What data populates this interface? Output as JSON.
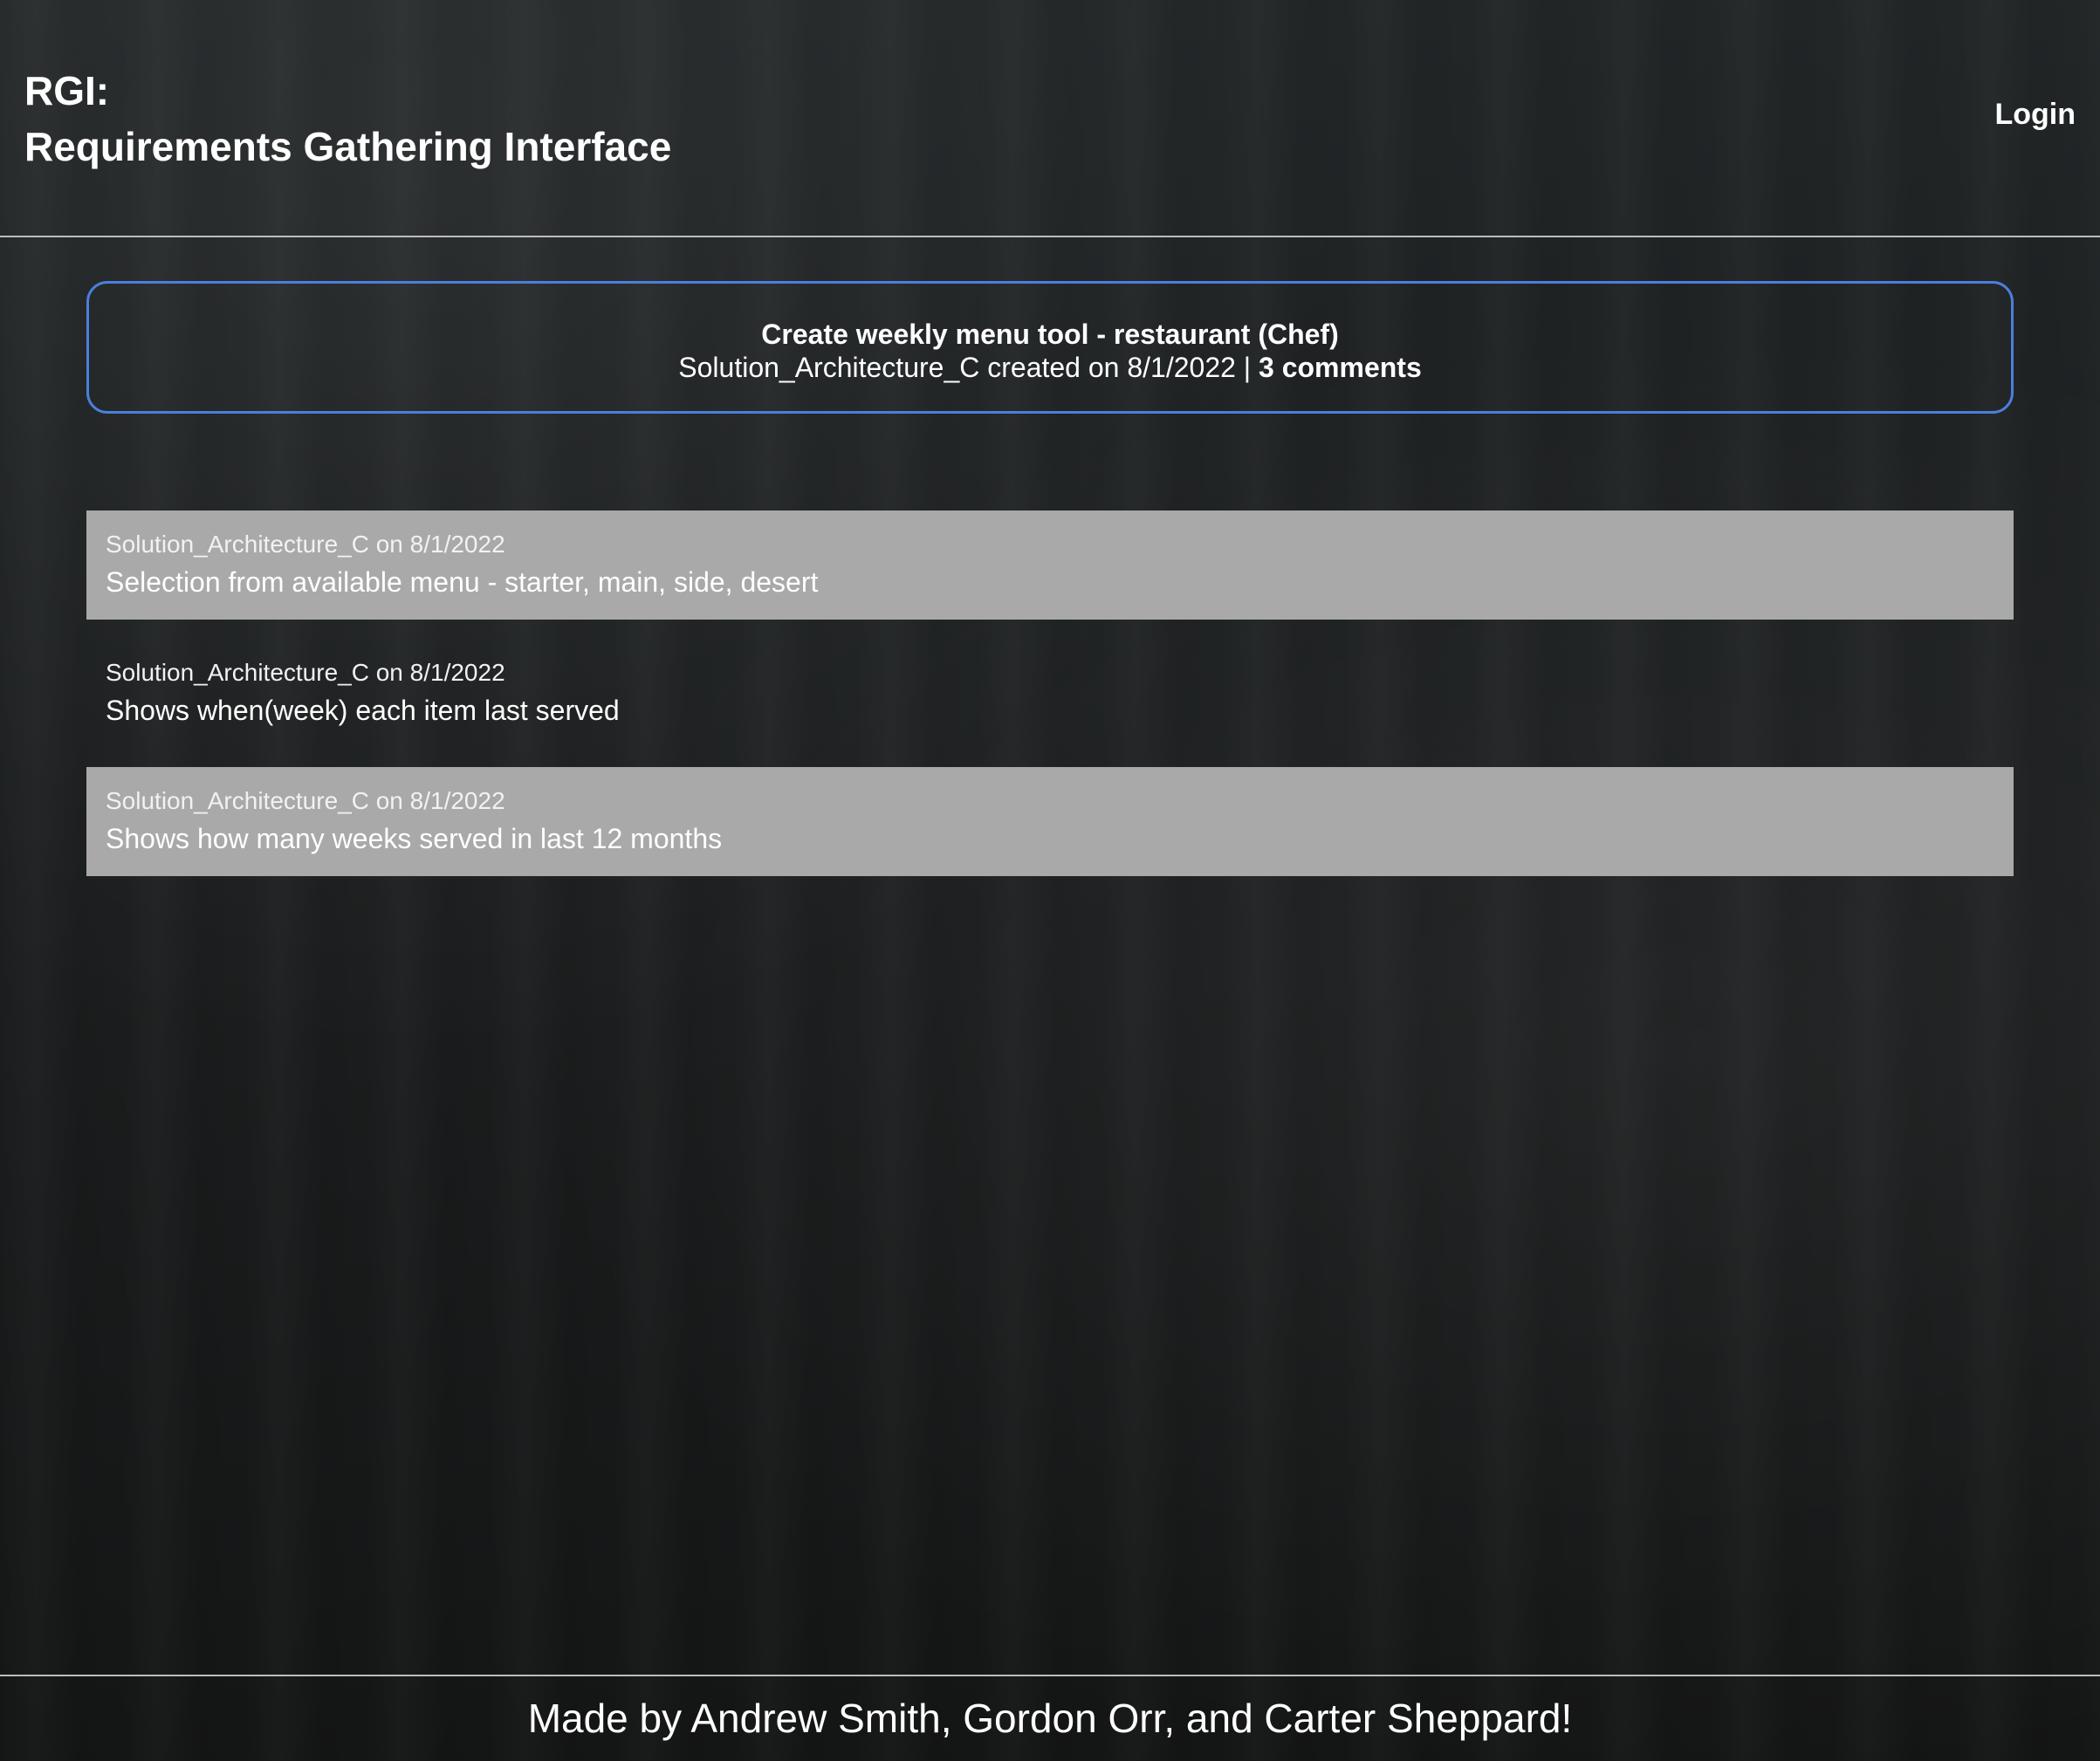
{
  "header": {
    "brand_line1": "RGI:",
    "brand_line2": "Requirements Gathering Interface",
    "login_label": "Login"
  },
  "requirement": {
    "title": "Create weekly menu tool - restaurant (Chef)",
    "author": "Solution_Architecture_C",
    "created_text": "created on 8/1/2022",
    "separator": "|",
    "comment_count": "3 comments"
  },
  "comments": [
    {
      "meta": "Solution_Architecture_C on 8/1/2022",
      "text": "Selection from available menu - starter, main, side, desert"
    },
    {
      "meta": "Solution_Architecture_C on 8/1/2022",
      "text": "Shows when(week) each item last served"
    },
    {
      "meta": "Solution_Architecture_C on 8/1/2022",
      "text": "Shows how many weeks served in last 12 months"
    }
  ],
  "footer": {
    "credits": "Made by Andrew Smith, Gordon Orr, and Carter Sheppard!"
  },
  "colors": {
    "accent_border": "#4a7fdc",
    "comment_highlight": "#a9a9a9",
    "text": "#ffffff"
  }
}
